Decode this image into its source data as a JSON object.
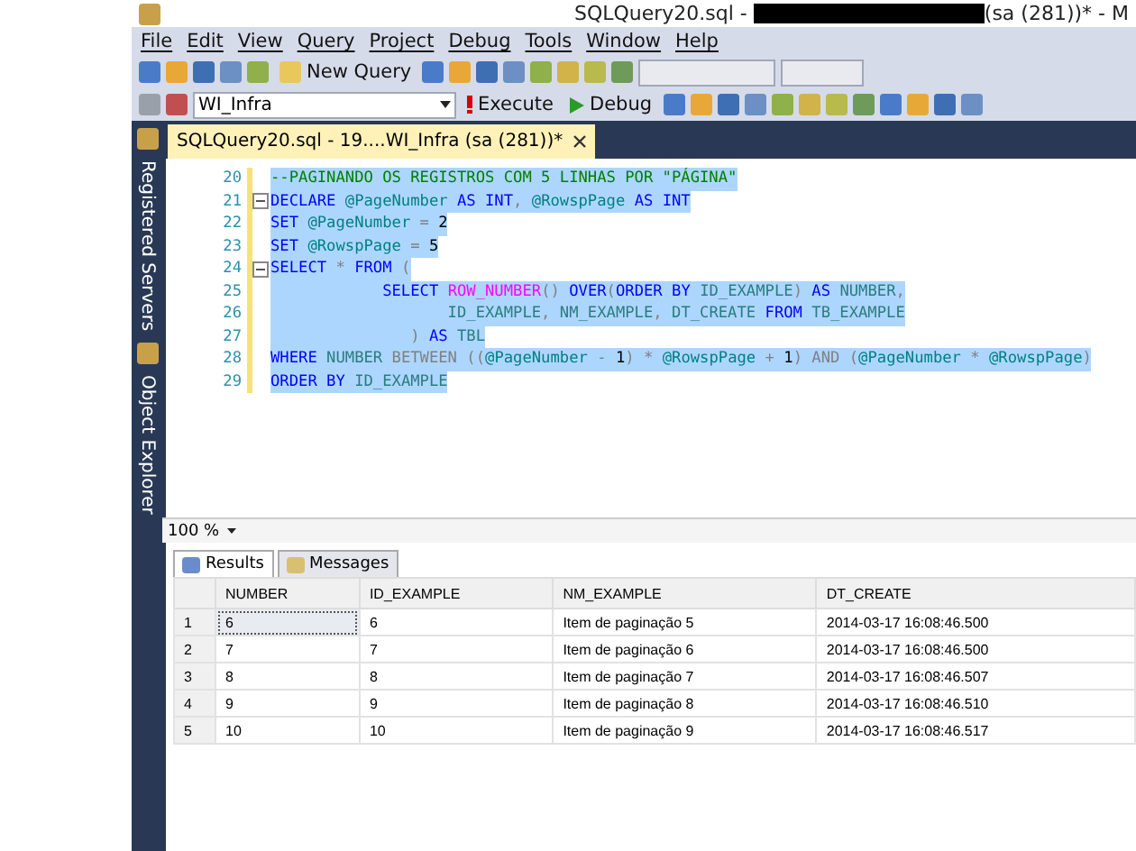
{
  "window": {
    "title_start": "SQLQuery20.sql - ",
    "title_redacted": true,
    "title_end": "(sa (281))* - M"
  },
  "menu": [
    "File",
    "Edit",
    "View",
    "Query",
    "Project",
    "Debug",
    "Tools",
    "Window",
    "Help"
  ],
  "toolbar": {
    "new_query": "New Query",
    "database": "WI_Infra",
    "execute": "Execute",
    "debug": "Debug"
  },
  "side_panels": [
    {
      "label": "Registered Servers"
    },
    {
      "label": "Object Explorer"
    }
  ],
  "doc_tab": {
    "label": "SQLQuery20.sql - 19....WI_Infra (sa (281))*",
    "selected": true
  },
  "editor": {
    "lines": [
      {
        "number": "20",
        "collapsible": false,
        "tokens": [
          {
            "kind": "cm",
            "text": "--PAGINANDO OS REGISTROS COM 5 LINHAS POR \"PÁGINA\""
          }
        ]
      },
      {
        "number": "21",
        "collapsible": true,
        "tokens": [
          {
            "kind": "kw",
            "text": "DECLARE"
          },
          {
            "kind": "var",
            "text": " @PageNumber "
          },
          {
            "kind": "kw",
            "text": "AS INT"
          },
          {
            "kind": "op",
            "text": ", "
          },
          {
            "kind": "var",
            "text": "@RowspPage "
          },
          {
            "kind": "kw",
            "text": "AS INT"
          }
        ]
      },
      {
        "number": "22",
        "collapsible": false,
        "tokens": [
          {
            "kind": "kw",
            "text": "SET"
          },
          {
            "kind": "var",
            "text": " @PageNumber "
          },
          {
            "kind": "op",
            "text": "= "
          },
          {
            "kind": "num",
            "text": "2"
          }
        ]
      },
      {
        "number": "23",
        "collapsible": false,
        "tokens": [
          {
            "kind": "kw",
            "text": "SET"
          },
          {
            "kind": "var",
            "text": " @RowspPage "
          },
          {
            "kind": "op",
            "text": "= "
          },
          {
            "kind": "num",
            "text": "5"
          }
        ]
      },
      {
        "number": "24",
        "collapsible": true,
        "tokens": [
          {
            "kind": "kw",
            "text": "SELECT"
          },
          {
            "kind": "op",
            "text": " * "
          },
          {
            "kind": "kw",
            "text": "FROM"
          },
          {
            "kind": "op",
            "text": " ("
          }
        ]
      },
      {
        "number": "25",
        "collapsible": false,
        "tokens": [
          {
            "kind": "kw",
            "text": "            SELECT "
          },
          {
            "kind": "fn",
            "text": "ROW_NUMBER"
          },
          {
            "kind": "op",
            "text": "() "
          },
          {
            "kind": "kw",
            "text": "OVER"
          },
          {
            "kind": "op",
            "text": "("
          },
          {
            "kind": "kw",
            "text": "ORDER BY "
          },
          {
            "kind": "id",
            "text": "ID_EXAMPLE"
          },
          {
            "kind": "op",
            "text": ") "
          },
          {
            "kind": "kw",
            "text": "AS "
          },
          {
            "kind": "id",
            "text": "NUMBER"
          },
          {
            "kind": "op",
            "text": ","
          }
        ]
      },
      {
        "number": "26",
        "collapsible": false,
        "tokens": [
          {
            "kind": "id",
            "text": "                   ID_EXAMPLE"
          },
          {
            "kind": "op",
            "text": ", "
          },
          {
            "kind": "id",
            "text": "NM_EXAMPLE"
          },
          {
            "kind": "op",
            "text": ", "
          },
          {
            "kind": "id",
            "text": "DT_CREATE "
          },
          {
            "kind": "kw",
            "text": "FROM "
          },
          {
            "kind": "id",
            "text": "TB_EXAMPLE"
          }
        ]
      },
      {
        "number": "27",
        "collapsible": false,
        "tokens": [
          {
            "kind": "op",
            "text": "               ) "
          },
          {
            "kind": "kw",
            "text": "AS "
          },
          {
            "kind": "id",
            "text": "TBL"
          }
        ]
      },
      {
        "number": "28",
        "collapsible": false,
        "tokens": [
          {
            "kind": "kw",
            "text": "WHERE "
          },
          {
            "kind": "id",
            "text": "NUMBER "
          },
          {
            "kind": "op",
            "text": "BETWEEN (("
          },
          {
            "kind": "var",
            "text": "@PageNumber "
          },
          {
            "kind": "op",
            "text": "- "
          },
          {
            "kind": "num",
            "text": "1"
          },
          {
            "kind": "op",
            "text": ") * "
          },
          {
            "kind": "var",
            "text": "@RowspPage "
          },
          {
            "kind": "op",
            "text": "+ "
          },
          {
            "kind": "num",
            "text": "1"
          },
          {
            "kind": "op",
            "text": ") AND ("
          },
          {
            "kind": "var",
            "text": "@PageNumber "
          },
          {
            "kind": "op",
            "text": "* "
          },
          {
            "kind": "var",
            "text": "@RowspPage"
          },
          {
            "kind": "op",
            "text": ")"
          }
        ]
      },
      {
        "number": "29",
        "collapsible": false,
        "tokens": [
          {
            "kind": "kw",
            "text": "ORDER BY "
          },
          {
            "kind": "id",
            "text": "ID_EXAMPLE"
          }
        ]
      }
    ]
  },
  "zoom": "100 %",
  "result_tabs": [
    {
      "label": "Results",
      "selected": true
    },
    {
      "label": "Messages",
      "selected": false
    }
  ],
  "table": {
    "columns": [
      "NUMBER",
      "ID_EXAMPLE",
      "NM_EXAMPLE",
      "DT_CREATE"
    ],
    "rows": [
      {
        "index": "1",
        "selected": true,
        "cells": [
          "6",
          "6",
          "Item de paginação 5",
          "2014-03-17 16:08:46.500"
        ]
      },
      {
        "index": "2",
        "selected": false,
        "cells": [
          "7",
          "7",
          "Item de paginação 6",
          "2014-03-17 16:08:46.500"
        ]
      },
      {
        "index": "3",
        "selected": false,
        "cells": [
          "8",
          "8",
          "Item de paginação 7",
          "2014-03-17 16:08:46.507"
        ]
      },
      {
        "index": "4",
        "selected": false,
        "cells": [
          "9",
          "9",
          "Item de paginação 8",
          "2014-03-17 16:08:46.510"
        ]
      },
      {
        "index": "5",
        "selected": false,
        "cells": [
          "10",
          "10",
          "Item de paginação 9",
          "2014-03-17 16:08:46.517"
        ]
      }
    ]
  }
}
